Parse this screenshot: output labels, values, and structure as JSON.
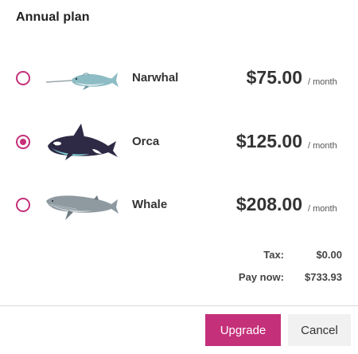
{
  "dialog": {
    "title": "Annual plan"
  },
  "plans": [
    {
      "name": "Narwhal",
      "price": "$75.00",
      "period": "/ month",
      "selected": false,
      "icon": "narwhal-icon"
    },
    {
      "name": "Orca",
      "price": "$125.00",
      "period": "/ month",
      "selected": true,
      "icon": "orca-icon"
    },
    {
      "name": "Whale",
      "price": "$208.00",
      "period": "/ month",
      "selected": false,
      "icon": "whale-icon"
    }
  ],
  "summary": {
    "tax_label": "Tax:",
    "tax_value": "$0.00",
    "pay_label": "Pay now:",
    "pay_value": "$733.93"
  },
  "footer": {
    "upgrade_label": "Upgrade",
    "cancel_label": "Cancel"
  },
  "colors": {
    "accent": "#c5307a",
    "cancel_bg": "#f1f1f1"
  }
}
